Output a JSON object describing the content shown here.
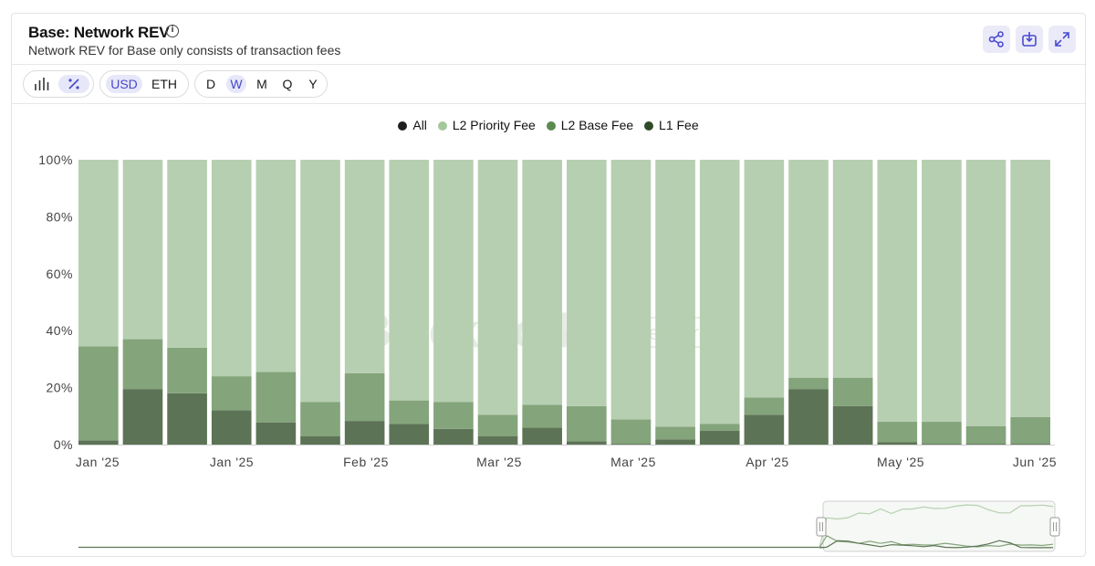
{
  "header": {
    "title": "Base: Network REV",
    "subtitle": "Network REV for Base only consists of transaction fees",
    "info_icon": "info-icon"
  },
  "toolbar": {
    "chart_type_icons": [
      "bar-chart-icon",
      "percent-icon"
    ],
    "chart_type_active": 1,
    "currencies": [
      "USD",
      "ETH"
    ],
    "currency_active": 0,
    "intervals": [
      "D",
      "W",
      "M",
      "Q",
      "Y"
    ],
    "interval_active": 1,
    "actions": [
      "share-icon",
      "download-icon",
      "expand-icon"
    ]
  },
  "watermark": {
    "brand": "Blockworks",
    "tag": "Research"
  },
  "colors": {
    "all": "#1e1e1e",
    "l2_priority": "#b7cfb1",
    "l2_base": "#84a47b",
    "l1": "#5c7455",
    "legend_l2_priority": "#a5c79b",
    "legend_l2_base": "#5c8a50",
    "legend_l1": "#2e4a28"
  },
  "chart_data": {
    "type": "bar",
    "stacked": true,
    "normalized": true,
    "legend": [
      "All",
      "L2 Priority Fee",
      "L2 Base Fee",
      "L1 Fee"
    ],
    "legend_position": "top-center",
    "ylim": [
      0,
      100
    ],
    "yticks": [
      "0%",
      "20%",
      "40%",
      "60%",
      "80%",
      "100%"
    ],
    "xticks": [
      "Jan '25",
      "Jan '25",
      "Feb '25",
      "Mar '25",
      "Mar '25",
      "Apr '25",
      "May '25",
      "Jun '25"
    ],
    "bar_count": 22,
    "series": [
      {
        "name": "L1 Fee",
        "values": [
          1.5,
          19.5,
          18,
          12,
          7.8,
          3,
          8.3,
          7.3,
          5.5,
          3,
          6,
          1.2,
          0.3,
          1.8,
          4.8,
          10.5,
          19.5,
          13.5,
          0.8,
          0.3,
          0.3,
          0.3
        ]
      },
      {
        "name": "L2 Base Fee",
        "values": [
          33,
          17.5,
          16,
          12,
          17.7,
          12,
          16.7,
          8.2,
          9.5,
          7.5,
          8,
          12.3,
          8.5,
          4.5,
          2.5,
          6,
          4,
          10,
          7.2,
          7.7,
          6.2,
          9.4
        ]
      },
      {
        "name": "L2 Priority Fee",
        "values": [
          65.5,
          63,
          66,
          76,
          74.5,
          85,
          75,
          84.5,
          85,
          89.5,
          86,
          86.5,
          91.2,
          93.7,
          92.7,
          83.5,
          76.5,
          76.5,
          92,
          92,
          93.5,
          90.3
        ]
      }
    ]
  }
}
